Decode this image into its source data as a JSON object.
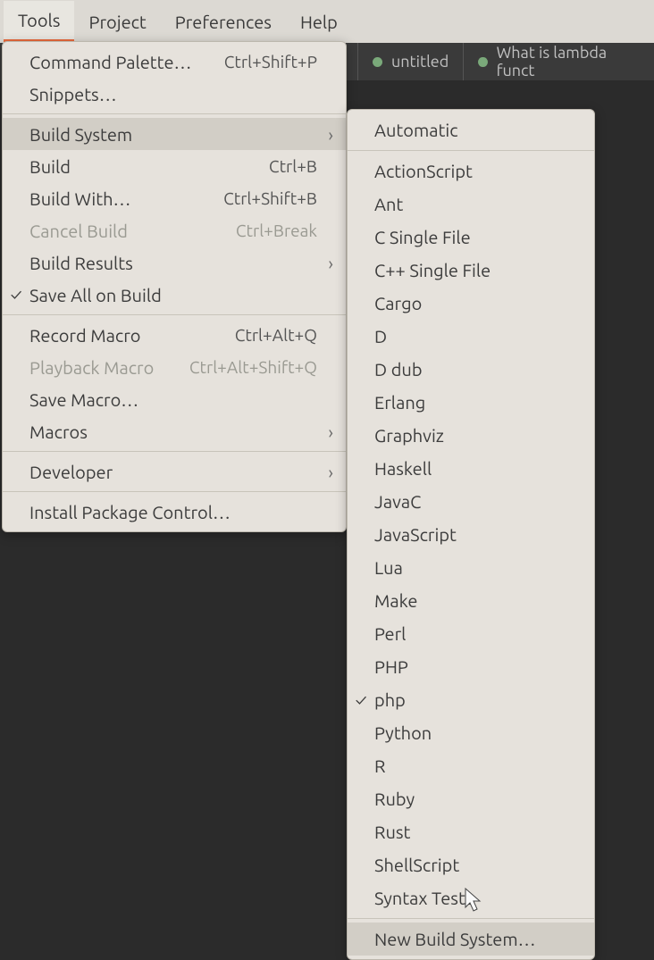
{
  "menubar": {
    "items": [
      "Tools",
      "Project",
      "Preferences",
      "Help"
    ]
  },
  "tabs": {
    "tab1": "untitled",
    "tab2": "What is lambda funct"
  },
  "tools_menu": {
    "command_palette": "Command Palette…",
    "command_palette_accel": "Ctrl+Shift+P",
    "snippets": "Snippets…",
    "build_system": "Build System",
    "build": "Build",
    "build_accel": "Ctrl+B",
    "build_with": "Build With…",
    "build_with_accel": "Ctrl+Shift+B",
    "cancel_build": "Cancel Build",
    "cancel_build_accel": "Ctrl+Break",
    "build_results": "Build Results",
    "save_all_on_build": "Save All on Build",
    "record_macro": "Record Macro",
    "record_macro_accel": "Ctrl+Alt+Q",
    "playback_macro": "Playback Macro",
    "playback_macro_accel": "Ctrl+Alt+Shift+Q",
    "save_macro": "Save Macro…",
    "macros": "Macros",
    "developer": "Developer",
    "install_package_control": "Install Package Control…"
  },
  "build_systems": {
    "items": [
      "Automatic",
      "ActionScript",
      "Ant",
      "C Single File",
      "C++ Single File",
      "Cargo",
      "D",
      "D dub",
      "Erlang",
      "Graphviz",
      "Haskell",
      "JavaC",
      "JavaScript",
      "Lua",
      "Make",
      "Perl",
      "PHP",
      "php",
      "Python",
      "R",
      "Ruby",
      "Rust",
      "ShellScript",
      "Syntax Tests"
    ],
    "checked_index": 17,
    "new_build_system": "New Build System…"
  }
}
